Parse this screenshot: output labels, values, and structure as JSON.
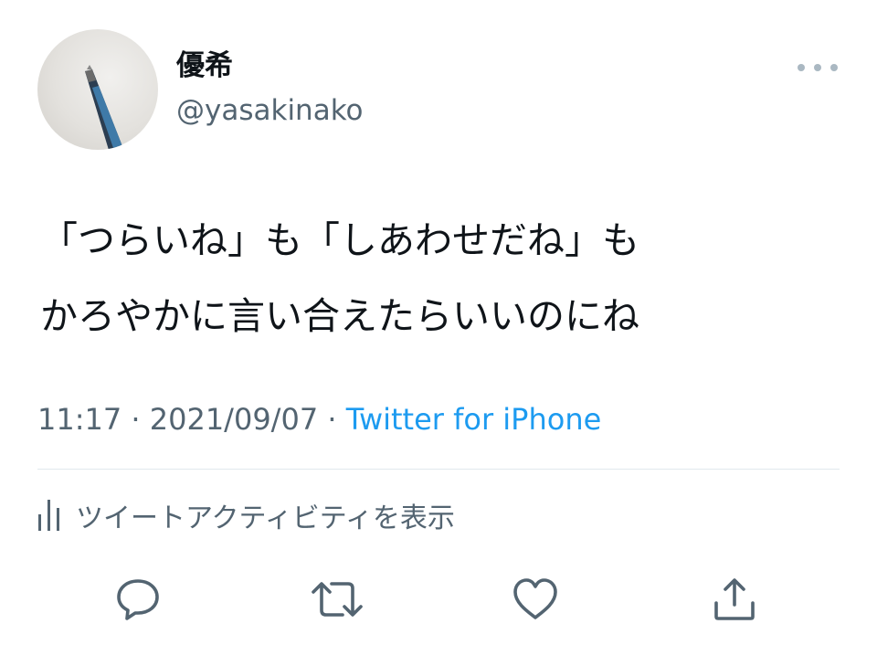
{
  "tweet": {
    "author_name": "優希",
    "author_handle": "@yasakinako",
    "text_line1": "「つらいね」も「しあわせだね」も",
    "text_line2": "かろやかに言い合えたらいいのにね",
    "time": "11:17",
    "date": "2021/09/07",
    "source": "Twitter for iPhone",
    "separator": " · ",
    "activity_label": "ツイートアクティビティを表示"
  },
  "icons": {
    "more": "more-options-icon",
    "activity": "bar-chart-icon",
    "reply": "reply-icon",
    "retweet": "retweet-icon",
    "like": "heart-icon",
    "share": "share-icon"
  },
  "colors": {
    "text": "#0f1419",
    "secondary": "#536471",
    "link": "#1d9bf0",
    "divider": "#e1e8ed"
  }
}
